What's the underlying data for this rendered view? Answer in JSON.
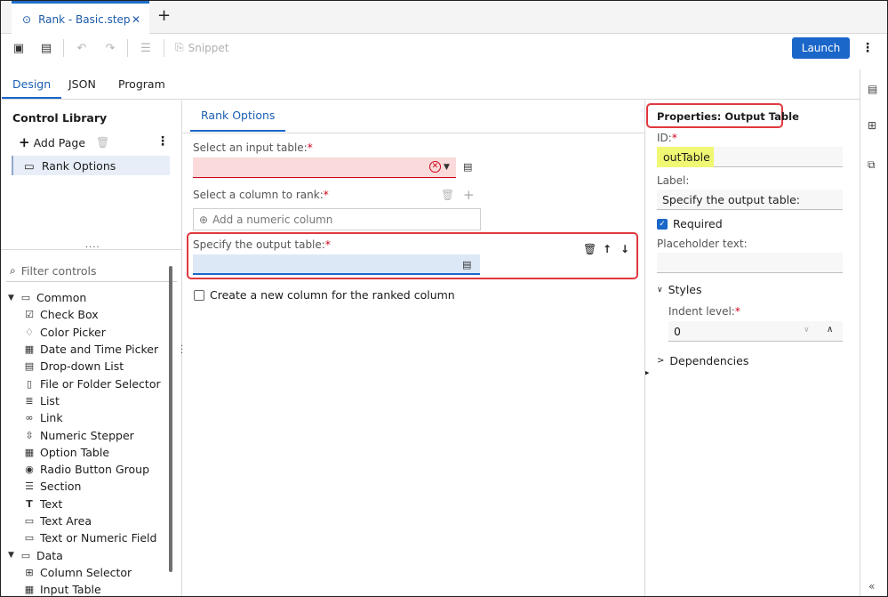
{
  "doc_tab": {
    "title": "Rank - Basic.step"
  },
  "toolbar": {
    "snippet_label": "Snippet",
    "launch_label": "Launch"
  },
  "view_tabs": [
    {
      "label": "Design",
      "active": true
    },
    {
      "label": "JSON",
      "active": false
    },
    {
      "label": "Program",
      "active": false
    }
  ],
  "control_library": {
    "title": "Control Library",
    "add_page_label": "Add Page",
    "pages": [
      "Rank Options"
    ],
    "filter_placeholder": "Filter controls",
    "groups": [
      {
        "label": "Common",
        "items": [
          "Check Box",
          "Color Picker",
          "Date and Time Picker",
          "Drop-down List",
          "File or Folder Selector",
          "List",
          "Link",
          "Numeric Stepper",
          "Option Table",
          "Radio Button Group",
          "Section",
          "Text",
          "Text Area",
          "Text or Numeric Field"
        ]
      },
      {
        "label": "Data",
        "items": [
          "Column Selector",
          "Input Table"
        ]
      }
    ]
  },
  "canvas": {
    "tab_label": "Rank Options",
    "input_table_label": "Select an input table:",
    "column_label": "Select a column to rank:",
    "column_placeholder": "Add a numeric column",
    "output_table_label": "Specify the output table:",
    "create_column_label": "Create a new column for the ranked column",
    "required_mark": "*"
  },
  "properties": {
    "title": "Properties: Output Table",
    "id_label": "ID:",
    "id_value": "outTable",
    "label_label": "Label:",
    "label_value": "Specify the output table:",
    "required_label": "Required",
    "placeholder_label": "Placeholder text:",
    "placeholder_value": "",
    "styles_label": "Styles",
    "indent_label": "Indent level:",
    "indent_value": "0",
    "dependencies_label": "Dependencies",
    "required_mark": "*"
  },
  "colors": {
    "accent": "#1a66c9",
    "error": "#d0021b",
    "highlight": "#e0383e",
    "id_highlight": "#f0f772"
  }
}
